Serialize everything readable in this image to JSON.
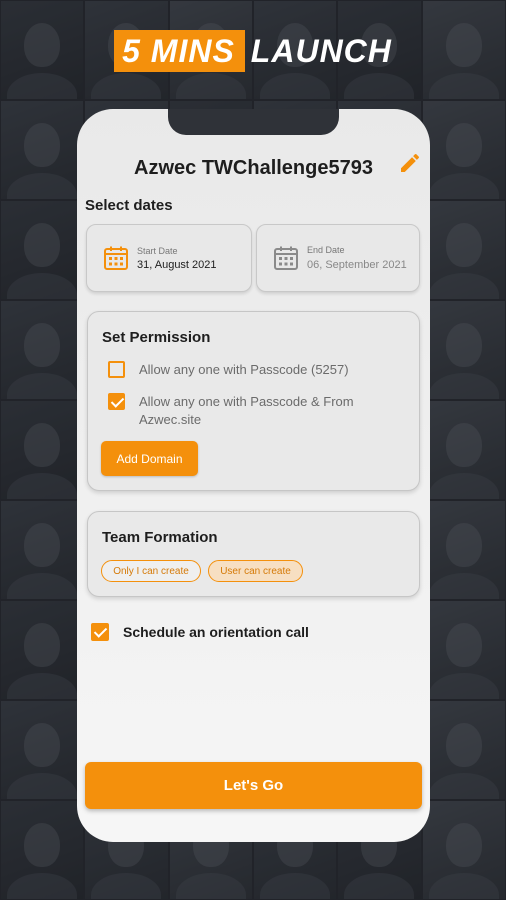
{
  "brand": {
    "highlight": "5 MINS",
    "text": "LAUNCH"
  },
  "challenge": {
    "title": "Azwec TWChallenge5793",
    "edit_icon": "pencil-icon"
  },
  "dates": {
    "section_label": "Select dates",
    "start": {
      "caption": "Start Date",
      "value": "31, August 2021",
      "icon": "calendar-icon"
    },
    "end": {
      "caption": "End Date",
      "value": "06, September 2021",
      "icon": "calendar-icon"
    }
  },
  "permission": {
    "title": "Set Permission",
    "options": [
      {
        "label": "Allow any one with Passcode (5257)",
        "checked": false
      },
      {
        "label": "Allow any one with Passcode & From Azwec.site",
        "checked": true
      }
    ],
    "add_domain_label": "Add Domain"
  },
  "team": {
    "title": "Team Formation",
    "options": [
      {
        "label": "Only I can create",
        "selected": false
      },
      {
        "label": "User can create",
        "selected": true
      }
    ]
  },
  "schedule": {
    "label": "Schedule an orientation call",
    "checked": true
  },
  "cta": {
    "label": "Let's Go"
  },
  "colors": {
    "accent": "#f4900c",
    "background": "#2b2f36",
    "card": "#e9e9e9"
  }
}
